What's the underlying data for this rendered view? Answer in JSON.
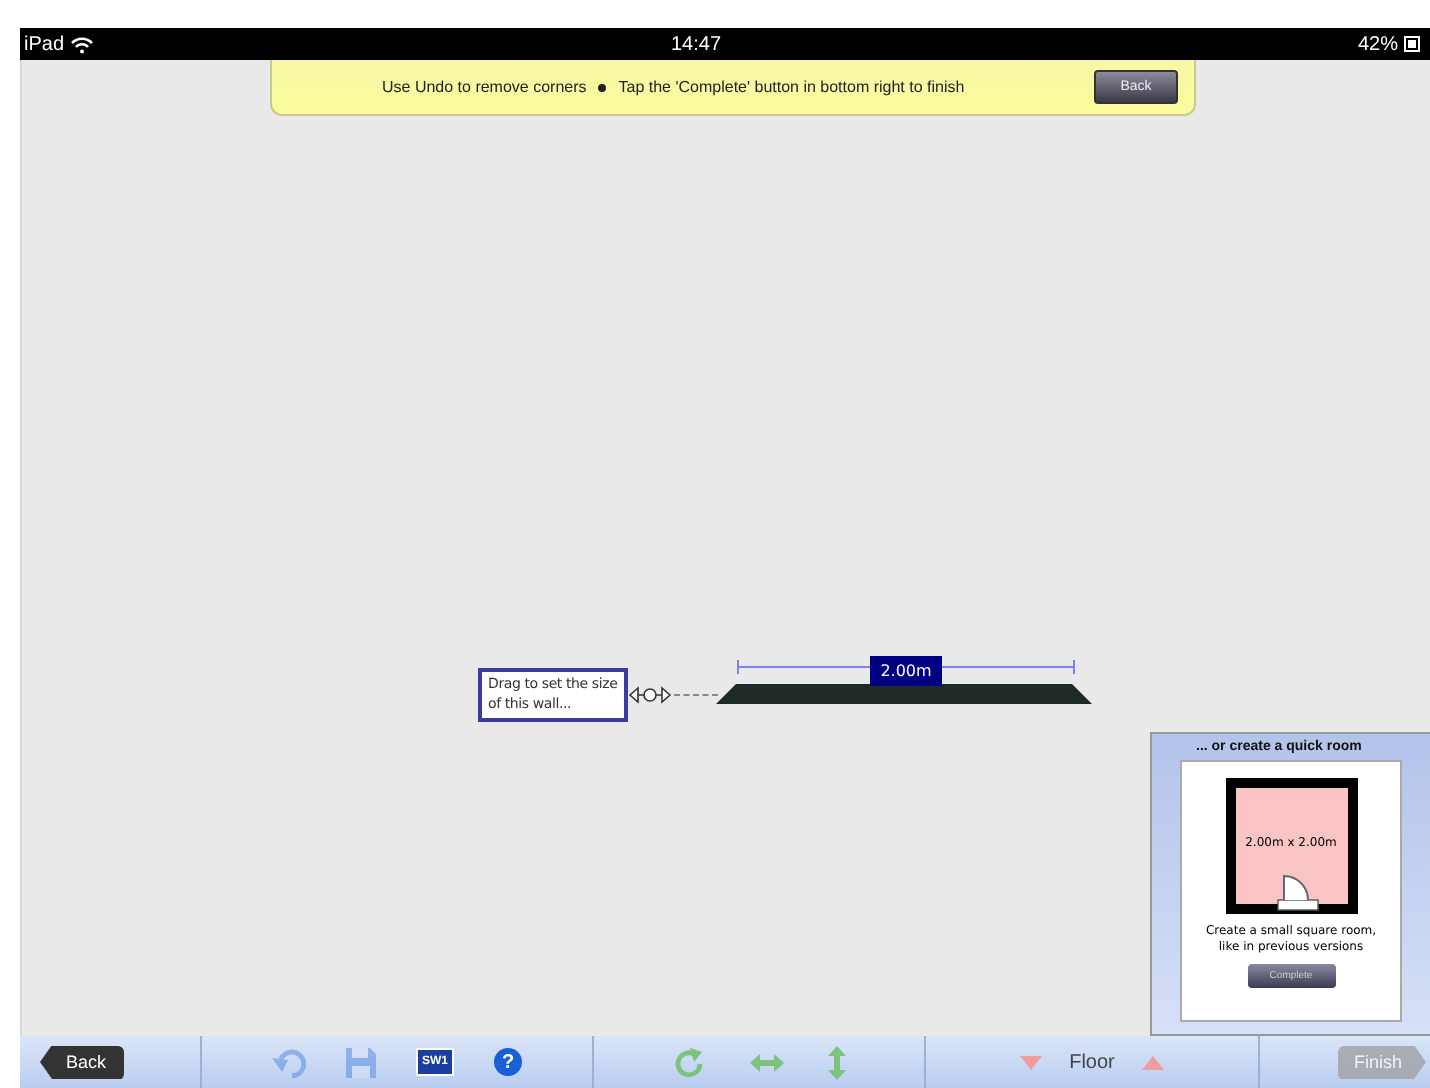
{
  "status_bar": {
    "carrier": "iPad",
    "time": "14:47",
    "battery": "42%"
  },
  "banner": {
    "hints": [
      "Use Undo to remove corners",
      "Tap the 'Complete' button in bottom right to finish"
    ],
    "back_button": "Back"
  },
  "wall": {
    "dimension": "2.00m",
    "tooltip": "Drag to set the size of this wall..."
  },
  "quick_room": {
    "title": "... or create a quick room",
    "room_label": "2.00m x 2.00m",
    "description": "Create a small square room, like in previous versions",
    "button": "Complete"
  },
  "toolbar": {
    "back": "Back",
    "tools": [
      {
        "kind": "undo",
        "disabled": true
      },
      {
        "kind": "save",
        "disabled": true
      },
      {
        "kind": "sw",
        "label": "SW1",
        "disabled": false
      },
      {
        "kind": "help",
        "label": "?",
        "disabled": false
      }
    ],
    "floor": "Floor",
    "finish": {
      "label": "Finish",
      "disabled": true
    }
  }
}
